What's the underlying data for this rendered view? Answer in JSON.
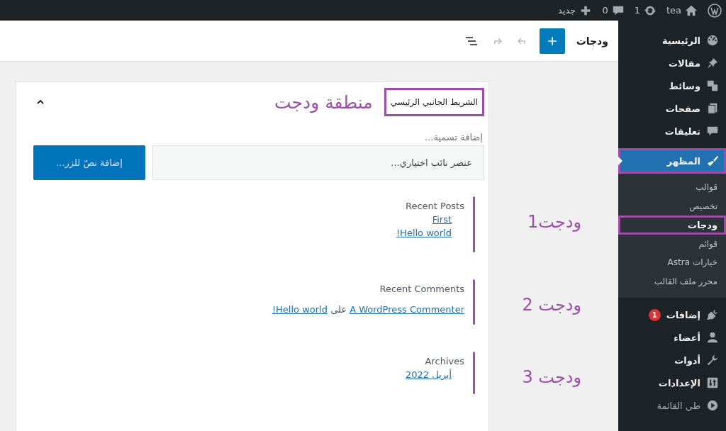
{
  "admin_bar": {
    "items": [
      {
        "kind": "logo"
      },
      {
        "kind": "site",
        "label": "tea"
      },
      {
        "kind": "updates",
        "label": "1"
      },
      {
        "kind": "comments",
        "label": "0"
      },
      {
        "kind": "new",
        "label": "جديد"
      }
    ]
  },
  "sidebar": {
    "items": [
      {
        "kind": "menu",
        "label": "الرئيسية",
        "selected": false,
        "annotated": false
      },
      {
        "kind": "menu",
        "label": "مقالات",
        "selected": false,
        "annotated": false
      },
      {
        "kind": "menu",
        "label": "وسائط",
        "selected": false,
        "annotated": false
      },
      {
        "kind": "menu",
        "label": "صفحات",
        "selected": false,
        "annotated": false
      },
      {
        "kind": "menu",
        "label": "تعليقات",
        "selected": false,
        "annotated": false
      },
      {
        "kind": "menu",
        "label": "المظهر",
        "selected": true,
        "annotated": true,
        "submenu": [
          {
            "label": "قوالب",
            "selected": false,
            "annotated": false
          },
          {
            "label": "تخصيص",
            "selected": false,
            "annotated": false
          },
          {
            "label": "ودجات",
            "selected": true,
            "annotated": true
          },
          {
            "label": "قوائم",
            "selected": false,
            "annotated": false
          },
          {
            "label": "خيارات Astra",
            "selected": false,
            "annotated": false
          },
          {
            "label": "محرر ملف القالب",
            "selected": false,
            "annotated": false
          }
        ]
      },
      {
        "kind": "menu",
        "label": "إضافات",
        "badge": "1",
        "selected": false,
        "annotated": false
      },
      {
        "kind": "menu",
        "label": "أعضاء",
        "selected": false,
        "annotated": false
      },
      {
        "kind": "menu",
        "label": "أدوات",
        "selected": false,
        "annotated": false
      },
      {
        "kind": "menu",
        "label": "الإعدادات",
        "selected": false,
        "annotated": false
      },
      {
        "kind": "collapse",
        "label": "طي القائمة",
        "selected": false,
        "annotated": false
      }
    ]
  },
  "editor_header": {
    "title": "ودجات"
  },
  "widget_area": {
    "title": "الشريط الجانبي الرئيسي",
    "annotated": true,
    "annotation": "منطقة ودجت",
    "expanded": true,
    "buttons_block": {
      "label_placeholder": "إضافة تسمية...",
      "field_placeholder": "عنصر نائب اختياري...",
      "button_placeholder": "إضافة نصّ للزر..."
    },
    "widgets": [
      {
        "kind": "list",
        "title": "Recent Posts",
        "links": [
          "First",
          "Hello world!"
        ],
        "annotation": "ودجت1"
      },
      {
        "kind": "comment",
        "title": "Recent Comments",
        "author": "A WordPress Commenter",
        "connector": "على",
        "post": "Hello world!",
        "annotation": "ودجت 2"
      },
      {
        "kind": "list",
        "title": "Archives",
        "links": [
          "أبريل 2022"
        ],
        "annotation": "ودجت 3"
      }
    ]
  }
}
